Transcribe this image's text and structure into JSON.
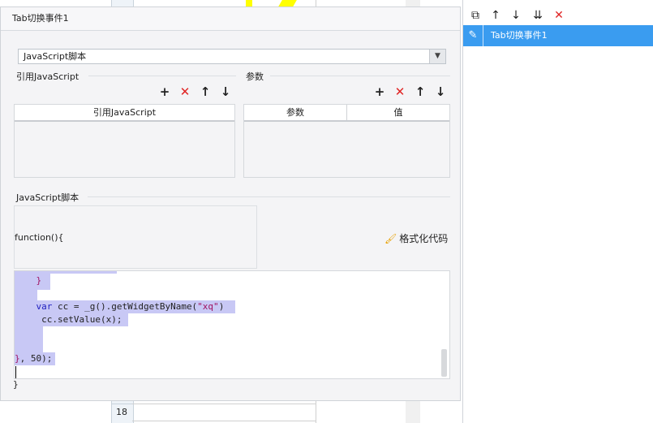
{
  "background": {
    "row_number": "18"
  },
  "dialog": {
    "title": "Tab切换事件1",
    "script_type_select": "JavaScript脚本",
    "ref_js_section": {
      "title": "引用JavaScript",
      "column": "引用JavaScript"
    },
    "params_section": {
      "title": "参数",
      "columns": [
        "参数",
        "值"
      ]
    },
    "script_section": {
      "title": "JavaScript脚本",
      "function_header": "function(){",
      "format_button": "格式化代码",
      "code_lines": {
        "l1": "    }",
        "l2_kw": "var",
        "l2_a": " cc = _g().getWidgetByName(",
        "l2_str": "\"xq\"",
        "l2_b": ")",
        "l3": "     cc.setValue(x);",
        "l4_brace": "}",
        "l4_rest": ", 50);"
      },
      "closing": "}"
    }
  },
  "right_panel": {
    "toolbar": [
      "copy-icon",
      "arrow-up-icon",
      "arrow-down-icon",
      "move-bottom-icon",
      "delete-icon"
    ],
    "item_label": "Tab切换事件1"
  },
  "colors": {
    "selected": "#3a9cf0",
    "delete": "#e02424",
    "selection": "#c8c8f5"
  }
}
